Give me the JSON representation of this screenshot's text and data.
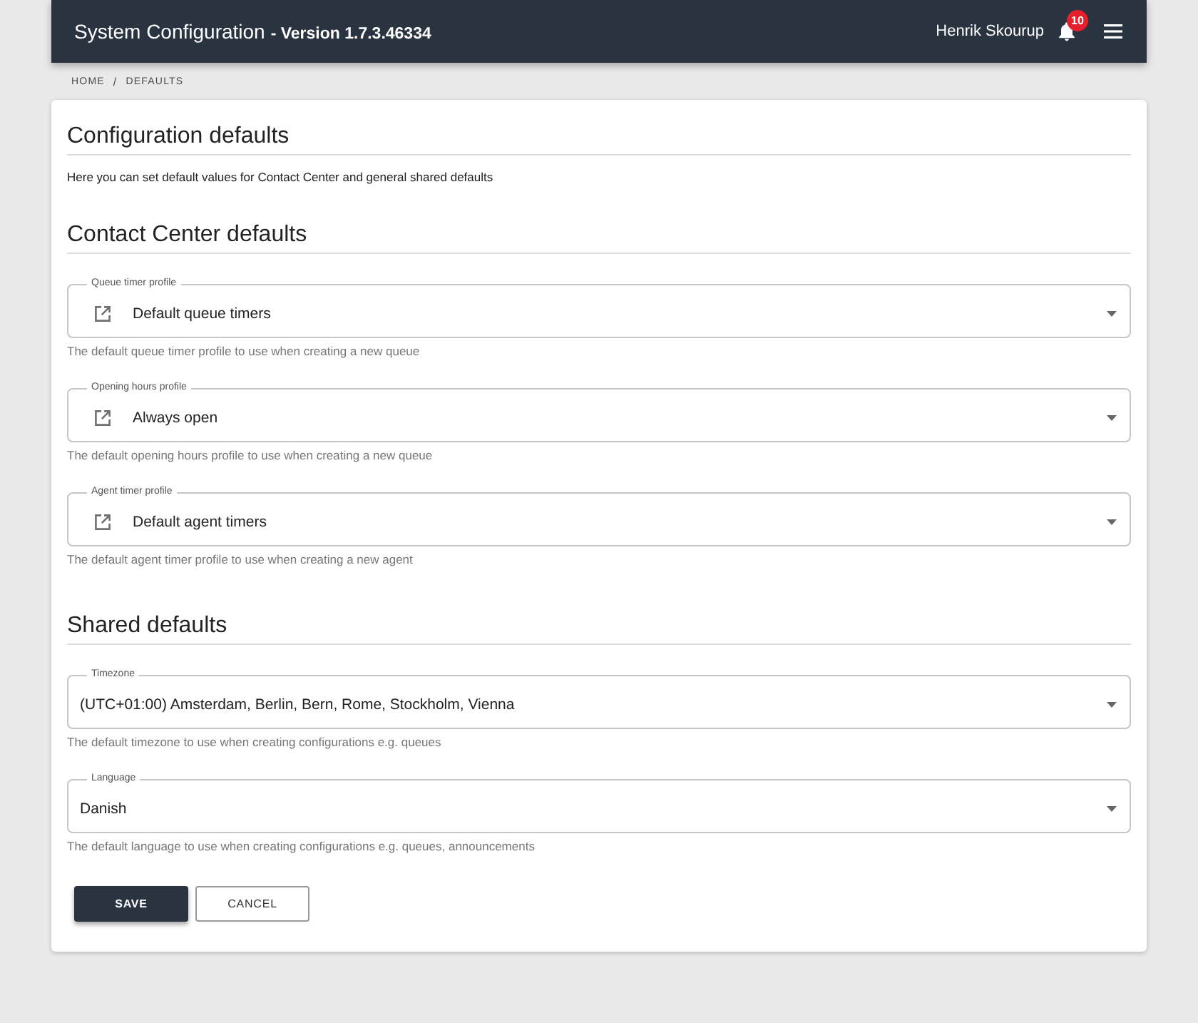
{
  "header": {
    "title": "System Configuration",
    "version": "- Version 1.7.3.46334",
    "user_name": "Henrik Skourup",
    "notification_count": "10"
  },
  "breadcrumb": {
    "items": [
      {
        "label": "HOME"
      },
      {
        "label": "DEFAULTS"
      }
    ],
    "separator": "/"
  },
  "page": {
    "title": "Configuration defaults",
    "description": "Here you can set default values for Contact Center and general shared defaults"
  },
  "sections": [
    {
      "title": "Contact Center defaults",
      "fields": [
        {
          "kind": "linked",
          "label": "Queue timer profile",
          "value": "Default queue timers",
          "helper": "The default queue timer profile to use when creating a new queue"
        },
        {
          "kind": "linked",
          "label": "Opening hours profile",
          "value": "Always open",
          "helper": "The default opening hours profile to use when creating a new queue"
        },
        {
          "kind": "linked",
          "label": "Agent timer profile",
          "value": "Default agent timers",
          "helper": "The default agent timer profile to use when creating a new agent"
        }
      ]
    },
    {
      "title": "Shared defaults",
      "fields": [
        {
          "kind": "plain",
          "label": "Timezone",
          "value": "(UTC+01:00) Amsterdam, Berlin, Bern, Rome, Stockholm, Vienna",
          "helper": "The default timezone to use when creating configurations e.g. queues"
        },
        {
          "kind": "plain",
          "label": "Language",
          "value": "Danish",
          "helper": "The default language to use when creating configurations e.g. queues, announcements"
        }
      ]
    }
  ],
  "buttons": [
    {
      "kind": "primary",
      "label": "SAVE"
    },
    {
      "kind": "secondary",
      "label": "CANCEL"
    }
  ]
}
